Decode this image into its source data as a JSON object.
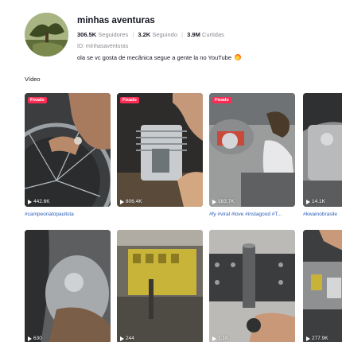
{
  "profile": {
    "name": "minhas aventuras",
    "followers_count": "306.5K",
    "followers_label": "Seguidores",
    "following_count": "3.2K",
    "following_label": "Seguindo",
    "likes_count": "3.9M",
    "likes_label": "Curtidas",
    "id_line": "ID: minhasaventuras",
    "bio": "ola se vc gosta de mecânica segue a gente la no YouTube"
  },
  "section": {
    "title": "Vídeo"
  },
  "videos": [
    {
      "pinned": "Fixado",
      "views": "442.6K",
      "caption": "#campeonatopaulista"
    },
    {
      "pinned": "Fixado",
      "views": "806.4K",
      "caption": ""
    },
    {
      "pinned": "Fixado",
      "views": "583.7K",
      "caption": "#fy #viral #love #instagood #T..."
    },
    {
      "pinned": "",
      "views": "14.1K",
      "caption": "#kwainobrasile"
    },
    {
      "pinned": "",
      "views": "630",
      "caption": ""
    },
    {
      "pinned": "",
      "views": "244",
      "caption": ""
    },
    {
      "pinned": "",
      "views": "1.1K",
      "caption": ""
    },
    {
      "pinned": "",
      "views": "277.9K",
      "caption": ""
    }
  ],
  "colors": {
    "pin_badge": "#fe2c55",
    "hashtag": "#2b5db9",
    "name": "#161823",
    "muted": "#8a8b91"
  }
}
